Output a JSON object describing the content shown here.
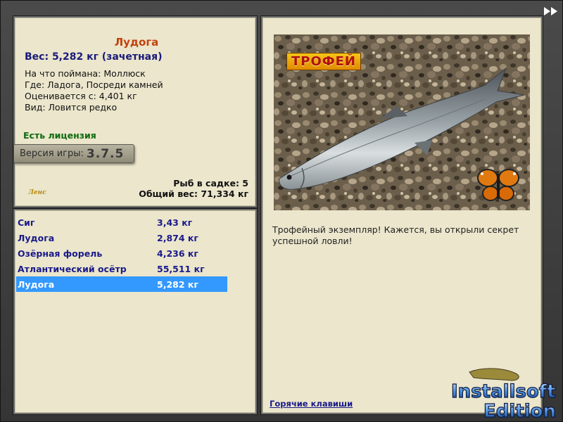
{
  "fish": {
    "title": "Лудога",
    "weight_line": "Вес: 5,282 кг (зачетная)",
    "details": [
      "На что поймана: Моллюск",
      "Где: Ладога, Посреди камней",
      "Оценивается с: 4,401 кг",
      "Вид: Ловится редко"
    ],
    "license": "Есть лицензия"
  },
  "version": {
    "label": "Версия игры:",
    "number": "3.7.5"
  },
  "small_logo": "Ленс",
  "sadok": {
    "count_line": "Рыб в садке: 5",
    "total_line": "Общий вес: 71,334 кг"
  },
  "catch_list": [
    {
      "name": "Сиг",
      "weight": "3,43 кг",
      "selected": false
    },
    {
      "name": "Лудога",
      "weight": "2,874 кг",
      "selected": false
    },
    {
      "name": "Озёрная форель",
      "weight": "4,236 кг",
      "selected": false
    },
    {
      "name": "Атлантический осётр",
      "weight": "55,511 кг",
      "selected": false
    },
    {
      "name": "Лудога",
      "weight": "5,282 кг",
      "selected": true
    }
  ],
  "trophy": {
    "label": "ТРОФЕЙ",
    "text": "Трофейный экземпляр! Кажется, вы открыли секрет успешной ловли!",
    "hotkeys": "Горячие клавиши"
  },
  "watermark": {
    "line1": "Installsoft",
    "line2": "Edition"
  },
  "icons": {
    "forward": "fast-forward-icon",
    "fish": "fish-photo",
    "butterfly": "butterfly-icon"
  },
  "colors": {
    "panel_bg": "#ebe6cc",
    "title": "#c2410c",
    "accent_blue": "#1a1a8a",
    "license_green": "#0f6a0f",
    "selected_bg": "#3399ff"
  }
}
